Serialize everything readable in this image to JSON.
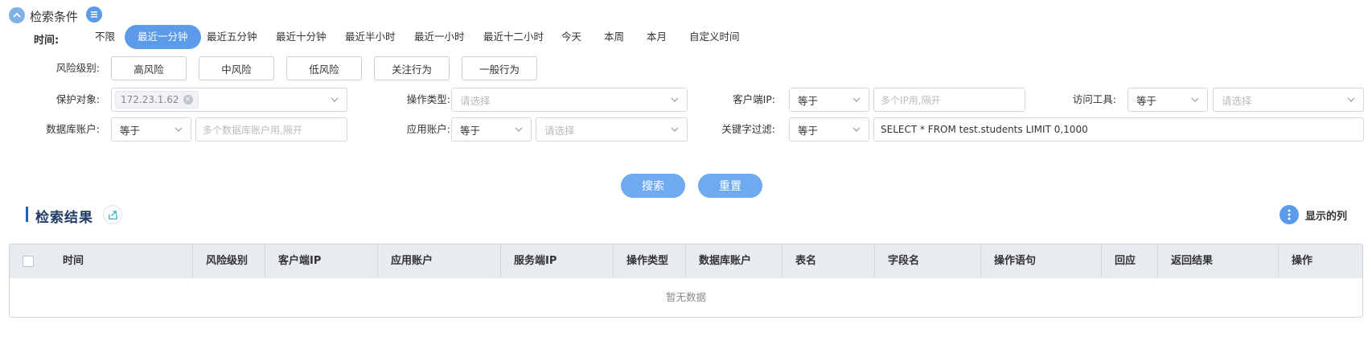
{
  "header": {
    "title": "检索条件"
  },
  "time": {
    "label": "时间:",
    "options": [
      "不限",
      "最近一分钟",
      "最近五分钟",
      "最近十分钟",
      "最近半小时",
      "最近一小时",
      "最近十二小时",
      "今天",
      "本周",
      "本月",
      "自定义时间"
    ],
    "active_index": 1
  },
  "risk": {
    "label": "风险级别:",
    "buttons": [
      "高风险",
      "中风险",
      "低风险",
      "关注行为",
      "一般行为"
    ]
  },
  "filters": {
    "protect_label": "保护对象:",
    "protect_tag": "172.23.1.62",
    "op_type_label": "操作类型:",
    "op_type_placeholder": "请选择",
    "client_ip_label": "客户端IP:",
    "client_ip_op": "等于",
    "client_ip_placeholder": "多个IP用,隔开",
    "tool_label": "访问工具:",
    "tool_op": "等于",
    "tool_placeholder": "请选择",
    "db_account_label": "数据库账户:",
    "db_account_op": "等于",
    "db_account_placeholder": "多个数据库账户用,隔开",
    "app_account_label": "应用账户:",
    "app_account_op": "等于",
    "app_account_placeholder": "请选择",
    "keyword_label": "关键字过滤:",
    "keyword_op": "等于",
    "keyword_value": "SELECT * FROM test.students LIMIT 0,1000"
  },
  "actions": {
    "search": "搜索",
    "reset": "重置"
  },
  "results": {
    "title": "检索结果",
    "show_columns": "显示的列",
    "columns": [
      "时间",
      "风险级别",
      "客户端IP",
      "应用账户",
      "服务端IP",
      "操作类型",
      "数据库账户",
      "表名",
      "字段名",
      "操作语句",
      "回应",
      "返回结果",
      "操作"
    ],
    "empty_text": "暂无数据"
  },
  "colors": {
    "accent": "#5b9bea",
    "button": "#6eaaf0",
    "title": "#1f3b63"
  }
}
